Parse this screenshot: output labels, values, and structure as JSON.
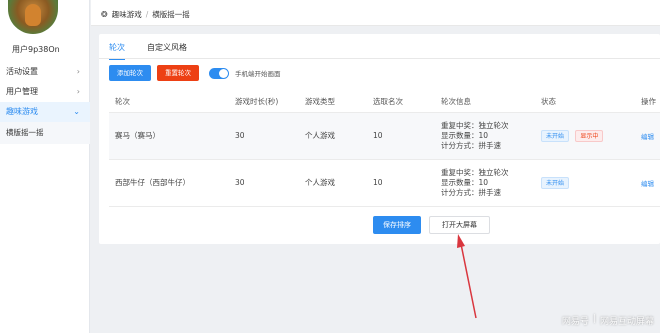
{
  "user": {
    "name": "用户9p38On"
  },
  "sidebar": {
    "items": [
      {
        "label": "活动设置",
        "chevron": "›"
      },
      {
        "label": "用户管理",
        "chevron": "›"
      },
      {
        "label": "趣味游戏",
        "chevron": "⌄"
      }
    ],
    "sub_item": "横版摇一摇"
  },
  "breadcrumb": {
    "icon": "game-icon",
    "first": "趣味游戏",
    "separator": "/",
    "second": "横版摇一摇"
  },
  "tabs": [
    "轮次",
    "自定义风格"
  ],
  "toolbar": {
    "add_round": "添加轮次",
    "reset_round": "重置轮次",
    "switch_label": "手机端开始画面",
    "switch_on": true
  },
  "table": {
    "headers": [
      "轮次",
      "游戏时长(秒)",
      "游戏类型",
      "选取名次",
      "轮次信息",
      "状态",
      "操作"
    ],
    "rows": [
      {
        "round": "赛马（赛马）",
        "duration": "30",
        "type": "个人游戏",
        "rank": "10",
        "info": [
          "重复中奖：独立轮次",
          "显示数量：10",
          "计分方式：拼手速"
        ],
        "status": "未开始",
        "status2": "显示中",
        "action": "编辑"
      },
      {
        "round": "西部牛仔（西部牛仔）",
        "duration": "30",
        "type": "个人游戏",
        "rank": "10",
        "info": [
          "重复中奖：独立轮次",
          "显示数量：10",
          "计分方式：拼手速"
        ],
        "status": "未开始",
        "action": "编辑"
      }
    ]
  },
  "buttons": {
    "save": "保存排序",
    "open_screen": "打开大屏幕"
  },
  "watermark": {
    "left": "网易号",
    "sep": "|",
    "right": "网易互动屏幕"
  },
  "colors": {
    "accent": "#2d8cf0",
    "danger": "#ed4014",
    "arrow": "#d9363e"
  }
}
